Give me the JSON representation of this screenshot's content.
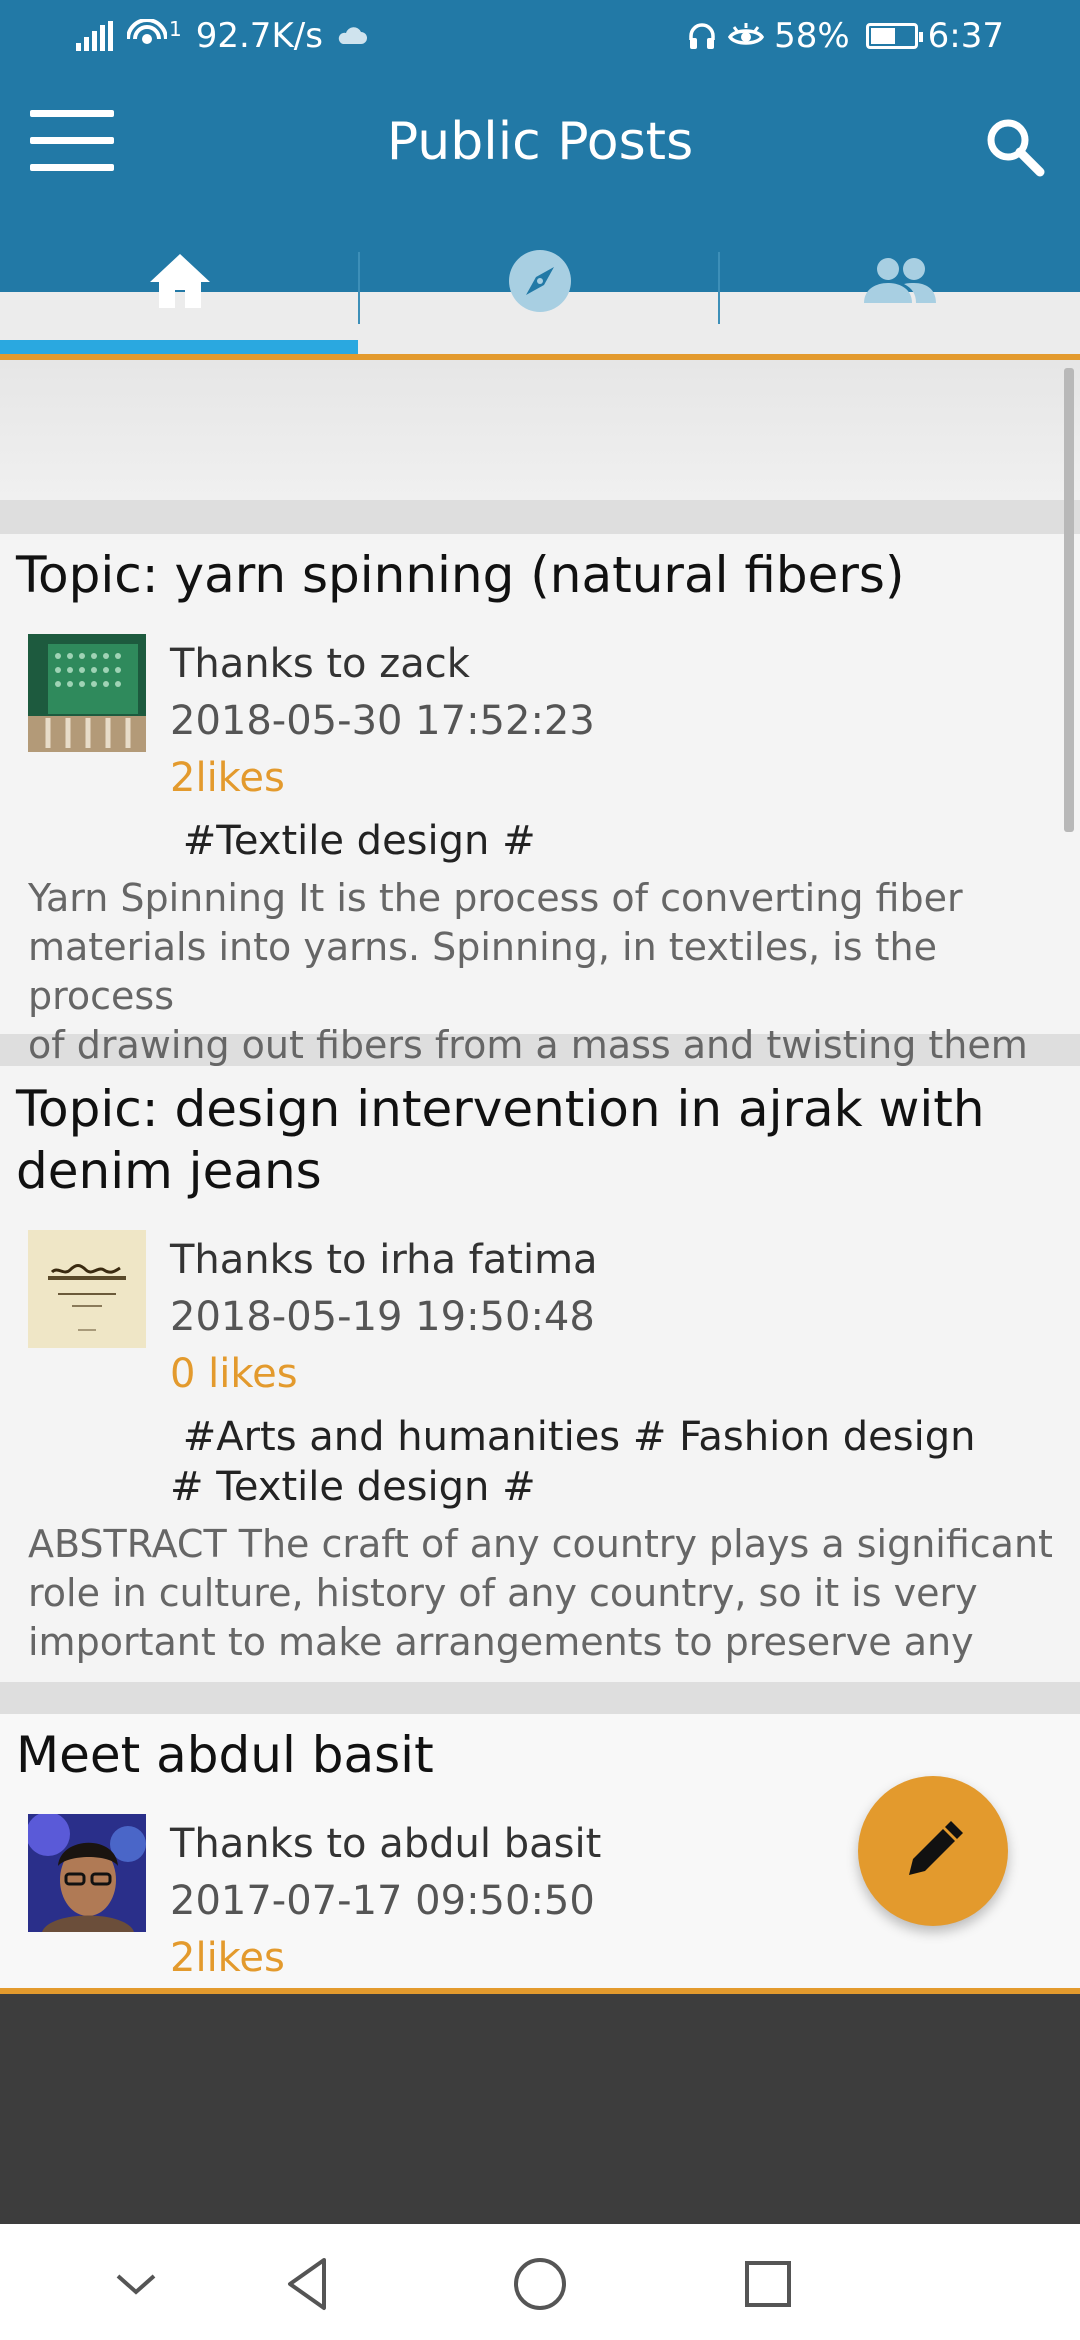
{
  "status_bar": {
    "network_speed": "92.7K/s",
    "wifi_badge": "1",
    "battery_percent": "58%",
    "battery_level": 0.58,
    "time": "6:37",
    "icons": [
      "signal-icon",
      "wifi-icon",
      "cloud-icon",
      "headset-icon",
      "eye-icon",
      "battery-icon"
    ]
  },
  "app_bar": {
    "title": "Public Posts",
    "menu_icon": "hamburger-icon",
    "search_icon": "search-icon"
  },
  "tabs": [
    {
      "icon": "home-icon",
      "selected": true
    },
    {
      "icon": "compass-icon",
      "selected": false
    },
    {
      "icon": "people-icon",
      "selected": false
    }
  ],
  "posts": [
    {
      "title": "Topic: yarn spinning (natural fibers)",
      "author": "Thanks to zack",
      "date": "2018-05-30 17:52:23",
      "likes": "2likes",
      "tags_lines": [
        " #Textile design #"
      ],
      "excerpt_lines": [
        "Yarn Spinning It is the process of converting fiber",
        "materials into yarns. Spinning, in textiles, is the process",
        "of drawing out fibers from a mass and twisting them"
      ]
    },
    {
      "title_lines": [
        "Topic: design intervention in ajrak with",
        "denim jeans"
      ],
      "author": "Thanks to irha fatima",
      "date": "2018-05-19 19:50:48",
      "likes": "0 likes",
      "tags_lines": [
        " #Arts and humanities # Fashion design",
        "# Textile design #"
      ],
      "excerpt_lines": [
        "ABSTRACT The craft of any country plays a significant",
        "role in culture, history of any country, so it is very",
        "important to make arrangements to preserve any"
      ]
    },
    {
      "title": "Meet abdul basit",
      "author": "Thanks to abdul basit",
      "date": "2017-07-17 09:50:50",
      "likes": "2likes"
    }
  ],
  "fab": {
    "icon": "pencil-icon"
  },
  "nav_bar": {
    "icons": [
      "chevron-down-icon",
      "back-icon",
      "home-circle-icon",
      "recents-square-icon"
    ]
  },
  "colors": {
    "primary": "#2279a6",
    "accent": "#e39a2d",
    "tab_indicator": "#2aa8e0"
  }
}
